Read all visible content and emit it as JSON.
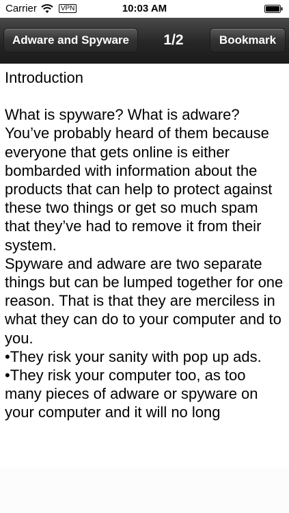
{
  "status_bar": {
    "carrier": "Carrier",
    "vpn": "VPN",
    "time": "10:03 AM"
  },
  "nav_bar": {
    "back_label": "Adware and Spyware",
    "page_indicator": "1/2",
    "bookmark_label": "Bookmark"
  },
  "article": {
    "heading": "Introduction",
    "paragraphs": [
      "What is spyware? What is adware? You’ve probably heard of them because everyone that gets online is either bombarded with information about the products that can help to protect against these two things or get so much spam that they’ve had to remove it from their system.",
      "Spyware and adware are two separate things but can be lumped together for one reason.  That is that they are merciless in what they can do to your computer and to you."
    ],
    "bullets": [
      "•They risk your sanity with pop up ads.",
      "•They risk your computer too, as too many pieces of adware or spyware on your computer and it will no long"
    ]
  }
}
